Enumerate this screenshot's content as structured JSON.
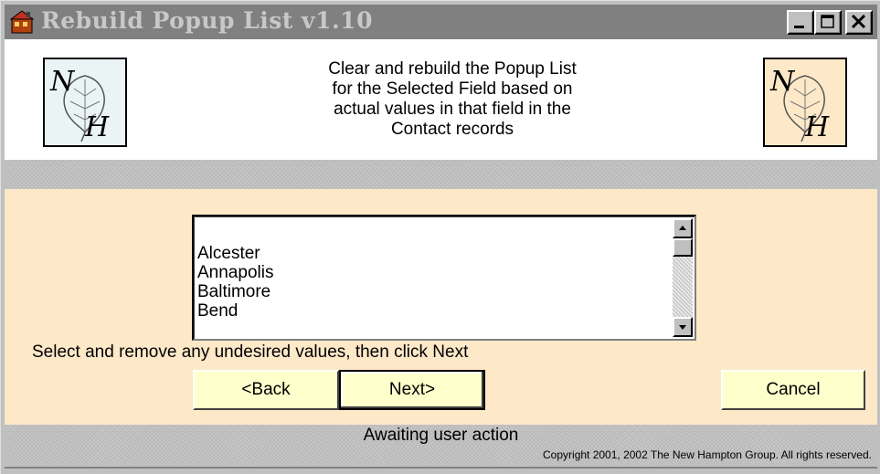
{
  "window": {
    "title": "Rebuild Popup List v1.10",
    "minimize_label": "minimize",
    "maximize_label": "maximize",
    "close_label": "close"
  },
  "header": {
    "description_lines": [
      "Clear and rebuild the Popup List",
      "for the Selected Field based on",
      "actual values in that field in the",
      "Contact records"
    ],
    "logo_letters": [
      "N",
      "H"
    ]
  },
  "list": {
    "items": [
      "",
      "Alcester",
      "Annapolis",
      "Baltimore",
      "Bend"
    ]
  },
  "instructions": "Select and remove any undesired values, then click Next",
  "buttons": {
    "back": "<Back",
    "next": "Next>",
    "cancel": "Cancel"
  },
  "status": "Awaiting user action",
  "copyright": "Copyright 2001, 2002 The New Hampton Group.  All rights reserved.",
  "colors": {
    "titlebar": "#808080",
    "panel": "#fde8c8",
    "button": "#ffffcc"
  }
}
